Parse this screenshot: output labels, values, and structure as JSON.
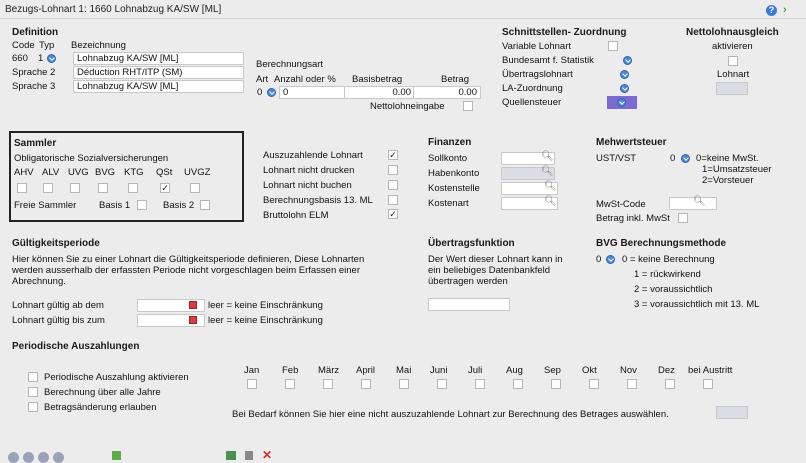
{
  "window": {
    "title": "Bezugs-Lohnart 1: 1660  Lohnabzug KA/SW [ML]"
  },
  "definition": {
    "header": "Definition",
    "col_code": "Code",
    "col_typ": "Typ",
    "col_bez": "Bezeichnung",
    "code": "660",
    "typ": "1",
    "bez1": "Lohnabzug KA/SW [ML]",
    "lang2_label": "Sprache 2",
    "bez2": "Déduction RHT/ITP (SM)",
    "lang3_label": "Sprache 3",
    "bez3": "Lohnabzug KA/SW [ML]"
  },
  "berechnung": {
    "label": "Berechnungsart",
    "col_art": "Art",
    "col_anzahl": "Anzahl oder %",
    "col_basis": "Basisbetrag",
    "col_betrag": "Betrag",
    "art": "0",
    "anzahl": "0",
    "basisbetrag": "0.00",
    "betrag": "0.00",
    "netto_label": "Nettolohneingabe"
  },
  "schnittstellen": {
    "header": "Schnittstellen- Zuordnung",
    "items": [
      "Variable Lohnart",
      "Bundesamt f. Statistik",
      "Übertragslohnart",
      "LA-Zuordnung",
      "Quellensteuer"
    ]
  },
  "nettolohn": {
    "header": "Nettolohnausgleich",
    "aktivieren": "aktivieren",
    "lohnart": "Lohnart"
  },
  "sammler": {
    "header": "Sammler",
    "subheader": "Obligatorische Sozialversicherungen",
    "cols": [
      "AHV",
      "ALV",
      "UVG",
      "BVG",
      "KTG",
      "QSt",
      "UVGZ"
    ],
    "checked": [
      false,
      false,
      false,
      false,
      false,
      true,
      false
    ],
    "freie": "Freie Sammler",
    "basis1": "Basis 1",
    "basis2": "Basis 2"
  },
  "options": {
    "items": [
      "Auszuzahlende Lohnart",
      "Lohnart nicht drucken",
      "Lohnart nicht buchen",
      "Berechnungsbasis 13. ML",
      "Bruttolohn ELM"
    ],
    "checked": [
      true,
      false,
      false,
      false,
      true
    ]
  },
  "finanzen": {
    "header": "Finanzen",
    "items": [
      "Sollkonto",
      "Habenkonto",
      "Kostenstelle",
      "Kostenart"
    ]
  },
  "mwst": {
    "header": "Mehwertsteuer",
    "ust_label": "UST/VST",
    "ust_value": "0",
    "legend1": "0=keine MwSt.",
    "legend2": "1=Umsatzsteuer",
    "legend3": "2=Vorsteuer",
    "code_label": "MwSt-Code",
    "inkl_label": "Betrag inkl. MwSt"
  },
  "gueltigkeit": {
    "header": "Gültigkeitsperiode",
    "text1": "Hier können Sie zu einer Lohnart die Gültigkeitsperiode definieren, Diese Lohnarten",
    "text2": "werden ausserhalb der erfassten Periode nicht vorgeschlagen beim Erfassen einer",
    "text3": "Abrechnung.",
    "ab_label": "Lohnart gültig ab dem",
    "bis_label": "Lohnart gültig bis  zum",
    "leer": "leer = keine Einschränkung"
  },
  "uebertrag": {
    "header": "Übertragsfunktion",
    "text1": "Der Wert dieser Lohnart kann in",
    "text2": "ein beliebiges Datenbankfeld",
    "text3": "übertragen werden"
  },
  "bvg": {
    "header": "BVG Berechnungsmethode",
    "value": "0",
    "opt0": "0 = keine Berechnung",
    "opt1": "1 = rückwirkend",
    "opt2": "2 = voraussichtlich",
    "opt3": "3 = voraussichtlich mit 13. ML"
  },
  "periodisch": {
    "header": "Periodische Auszahlungen",
    "options": [
      "Periodische Auszahlung aktivieren",
      "Berechnung über alle Jahre",
      "Betragsänderung erlauben"
    ],
    "months": [
      "Jan",
      "Feb",
      "März",
      "April",
      "Mai",
      "Juni",
      "Juli",
      "Aug",
      "Sep",
      "Okt",
      "Nov",
      "Dez",
      "bei Austritt"
    ],
    "hint": "Bei Bedarf können Sie hier eine nicht auszuzahlende Lohnart zur Berechnung des Betrages auswählen."
  },
  "icons": {
    "help": "help-icon",
    "next": "arrow-right-icon",
    "search": "search-icon",
    "calendar": "calendar-icon"
  },
  "colors": {
    "accent": "#4a86d4",
    "selected_field": "#7b6ad0",
    "readonly_field": "#dcdce4"
  }
}
